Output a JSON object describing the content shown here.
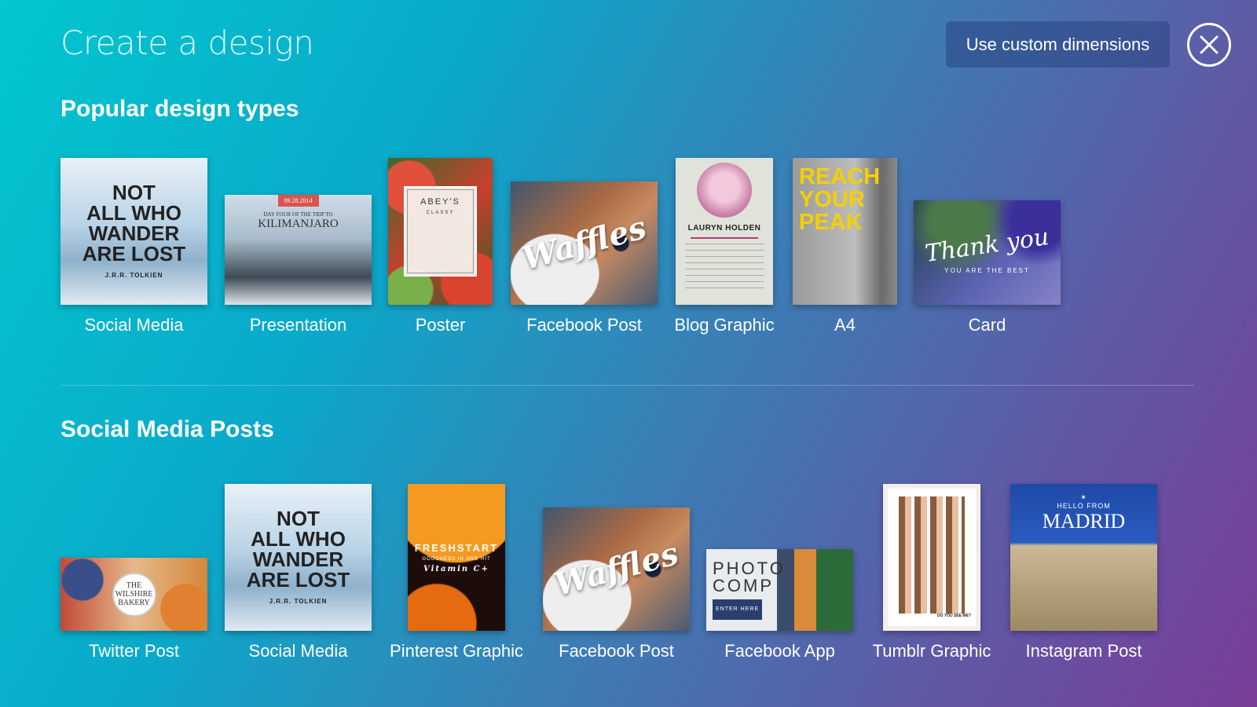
{
  "header": {
    "title": "Create a design",
    "custom_button": "Use custom dimensions"
  },
  "sections": [
    {
      "title": "Popular design types",
      "items": [
        {
          "label": "Social Media",
          "thumb": [
            "NOT",
            "ALL WHO",
            "WANDER",
            "ARE LOST",
            "J.R.R. TOLKIEN"
          ]
        },
        {
          "label": "Presentation",
          "thumb": [
            "09.28.2014",
            "DAY FOUR OF THE TRIP TO",
            "KILIMANJARO"
          ]
        },
        {
          "label": "Poster",
          "thumb": [
            "ABEY'S",
            "CLASSY"
          ]
        },
        {
          "label": "Facebook Post",
          "thumb": [
            "Waffles"
          ]
        },
        {
          "label": "Blog Graphic",
          "thumb": [
            "LAURYN HOLDEN"
          ]
        },
        {
          "label": "A4",
          "thumb": [
            "REACH",
            "YOUR",
            "PEAK"
          ]
        },
        {
          "label": "Card",
          "thumb": [
            "Thank you",
            "YOU ARE THE BEST"
          ]
        }
      ]
    },
    {
      "title": "Social Media Posts",
      "items": [
        {
          "label": "Twitter Post",
          "thumb": [
            "THE WILSHIRE BAKERY"
          ]
        },
        {
          "label": "Social Media",
          "thumb": [
            "NOT",
            "ALL WHO",
            "WANDER",
            "ARE LOST",
            "J.R.R. TOLKIEN"
          ]
        },
        {
          "label": "Pinterest Graphic",
          "thumb": [
            "FRESHSTART",
            "GOODNESS IN ONE HIT",
            "Vitamin C+"
          ]
        },
        {
          "label": "Facebook Post",
          "thumb": [
            "Waffles"
          ]
        },
        {
          "label": "Facebook App",
          "thumb": [
            "PHOTO",
            "COMP",
            "ENTER HERE"
          ]
        },
        {
          "label": "Tumblr Graphic",
          "thumb": [
            "DO YOU SEE ME?"
          ]
        },
        {
          "label": "Instagram Post",
          "thumb": [
            "HELLO FROM",
            "MADRID"
          ]
        }
      ]
    }
  ]
}
